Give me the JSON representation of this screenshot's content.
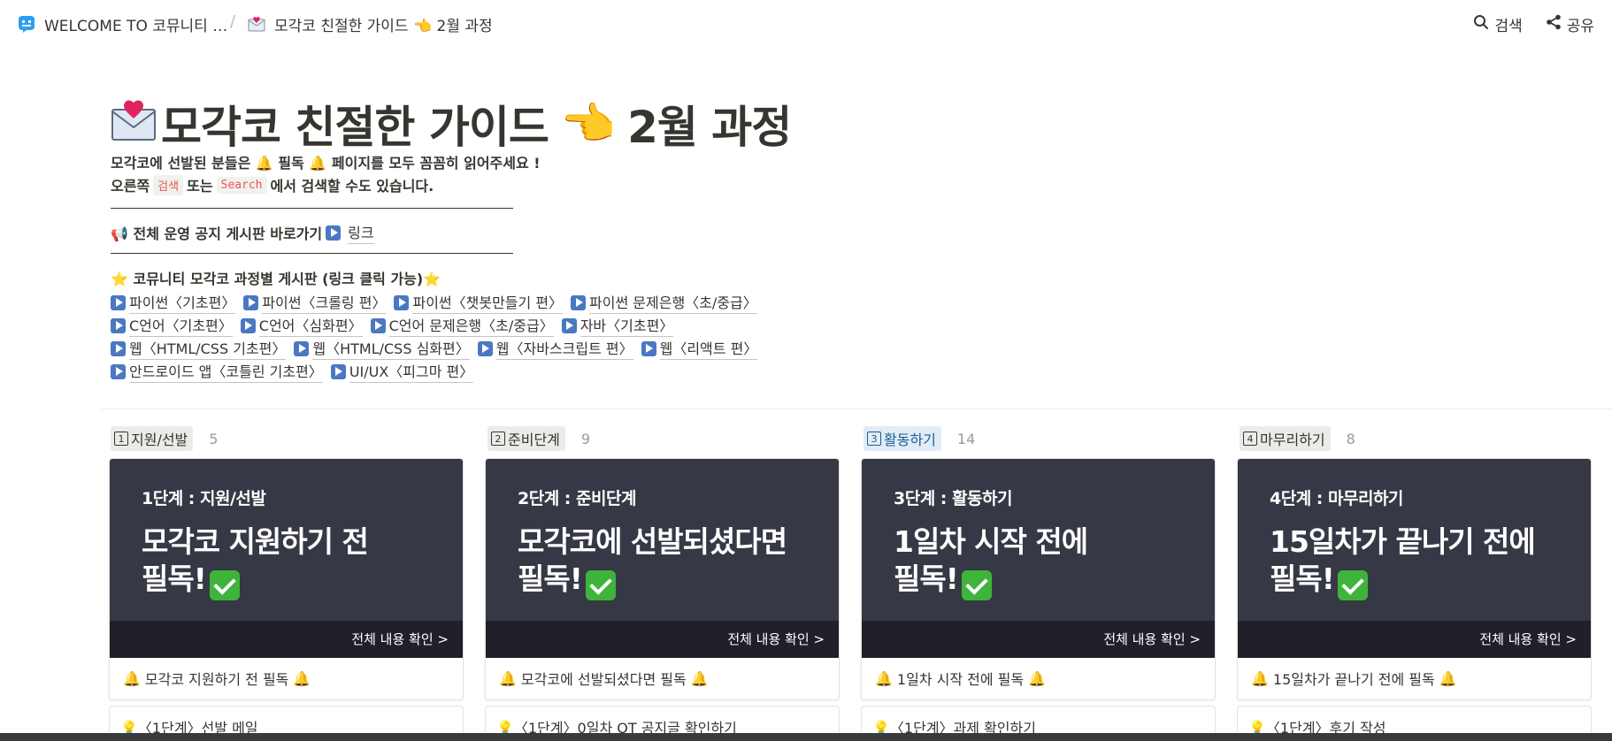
{
  "breadcrumb": {
    "workspace": "WELCOME TO 코뮤니티 …",
    "separator": "/",
    "page": "모각코 친절한 가이드 👈 2월 과정"
  },
  "top_actions": {
    "search": "검색",
    "share": "공유"
  },
  "page": {
    "title_main": "모각코 친절한 가이드",
    "title_hand": "👈",
    "title_tail": "2월 과정",
    "intro_line1": "모각코에 선발된 분들은 🔔 필독 🔔 페이지를 모두 꼼꼼히 읽어주세요 !",
    "intro_line2_pre": "오른쪽",
    "intro_code1": "검색",
    "intro_mid": "또는",
    "intro_code2": "Search",
    "intro_line2_post": "에서 검색할 수도 있습니다.",
    "notice_label": "📢 전체 운영 공지 게시판 바로가기",
    "notice_link": "링크",
    "board_label": "⭐ 코뮤니티 모각코 과정별 게시판 (링크 클릭 가능)⭐"
  },
  "course_links": [
    [
      "파이썬〈기초편〉",
      "파이썬〈크롤링 편〉",
      "파이썬〈챗봇만들기 편〉",
      "파이썬 문제은행〈초/중급〉"
    ],
    [
      "C언어〈기초편〉",
      "C언어〈심화편〉",
      "C언어 문제은행〈초/중급〉",
      "자바〈기초편〉"
    ],
    [
      "웹〈HTML/CSS 기초편〉",
      "웹〈HTML/CSS 심화편〉",
      "웹〈자바스크립트 편〉",
      "웹〈리액트 편〉"
    ],
    [
      "안드로이드 앱〈코틀린 기초편〉",
      "UI/UX〈피그마 편〉"
    ]
  ],
  "columns": [
    {
      "num": "1",
      "label": "지원/선발",
      "count": "5",
      "stage": "1단계 :  지원/선발",
      "headline1": "모각코 지원하기 전",
      "headline2": "필독!",
      "cta": "전체 내용 확인 >",
      "card_title": "모각코 지원하기 전 필독",
      "next_card": "💡〈1단계〉선발 메일"
    },
    {
      "num": "2",
      "label": "준비단계",
      "count": "9",
      "stage": "2단계 : 준비단계",
      "headline1": "모각코에 선발되셨다면",
      "headline2": "필독!",
      "cta": "전체 내용 확인 >",
      "card_title": "모각코에 선발되셨다면 필독",
      "next_card": "💡〈1단계〉0일차 OT 공지글 확인하기"
    },
    {
      "num": "3",
      "label": "활동하기",
      "count": "14",
      "stage": "3단계 : 활동하기",
      "headline1": "1일차 시작 전에",
      "headline2": "필독!",
      "cta": "전체 내용 확인 >",
      "card_title": "1일차 시작 전에 필독",
      "next_card": "💡〈1단계〉과제 확인하기"
    },
    {
      "num": "4",
      "label": "마무리하기",
      "count": "8",
      "stage": "4단계 : 마무리하기",
      "headline1": "15일차가 끝나기 전에",
      "headline2": "필독!",
      "cta": "전체 내용 확인 >",
      "card_title": "15일차가 끝나기 전에 필독",
      "next_card": "💡〈1단계〉후기 작성"
    }
  ],
  "colors": {
    "cover_bg": "#363945",
    "cover_footer": "#1f2028",
    "check_green": "#3fb43a",
    "active_tag_bg": "#e1ecf7",
    "code_red": "#eb5757"
  }
}
